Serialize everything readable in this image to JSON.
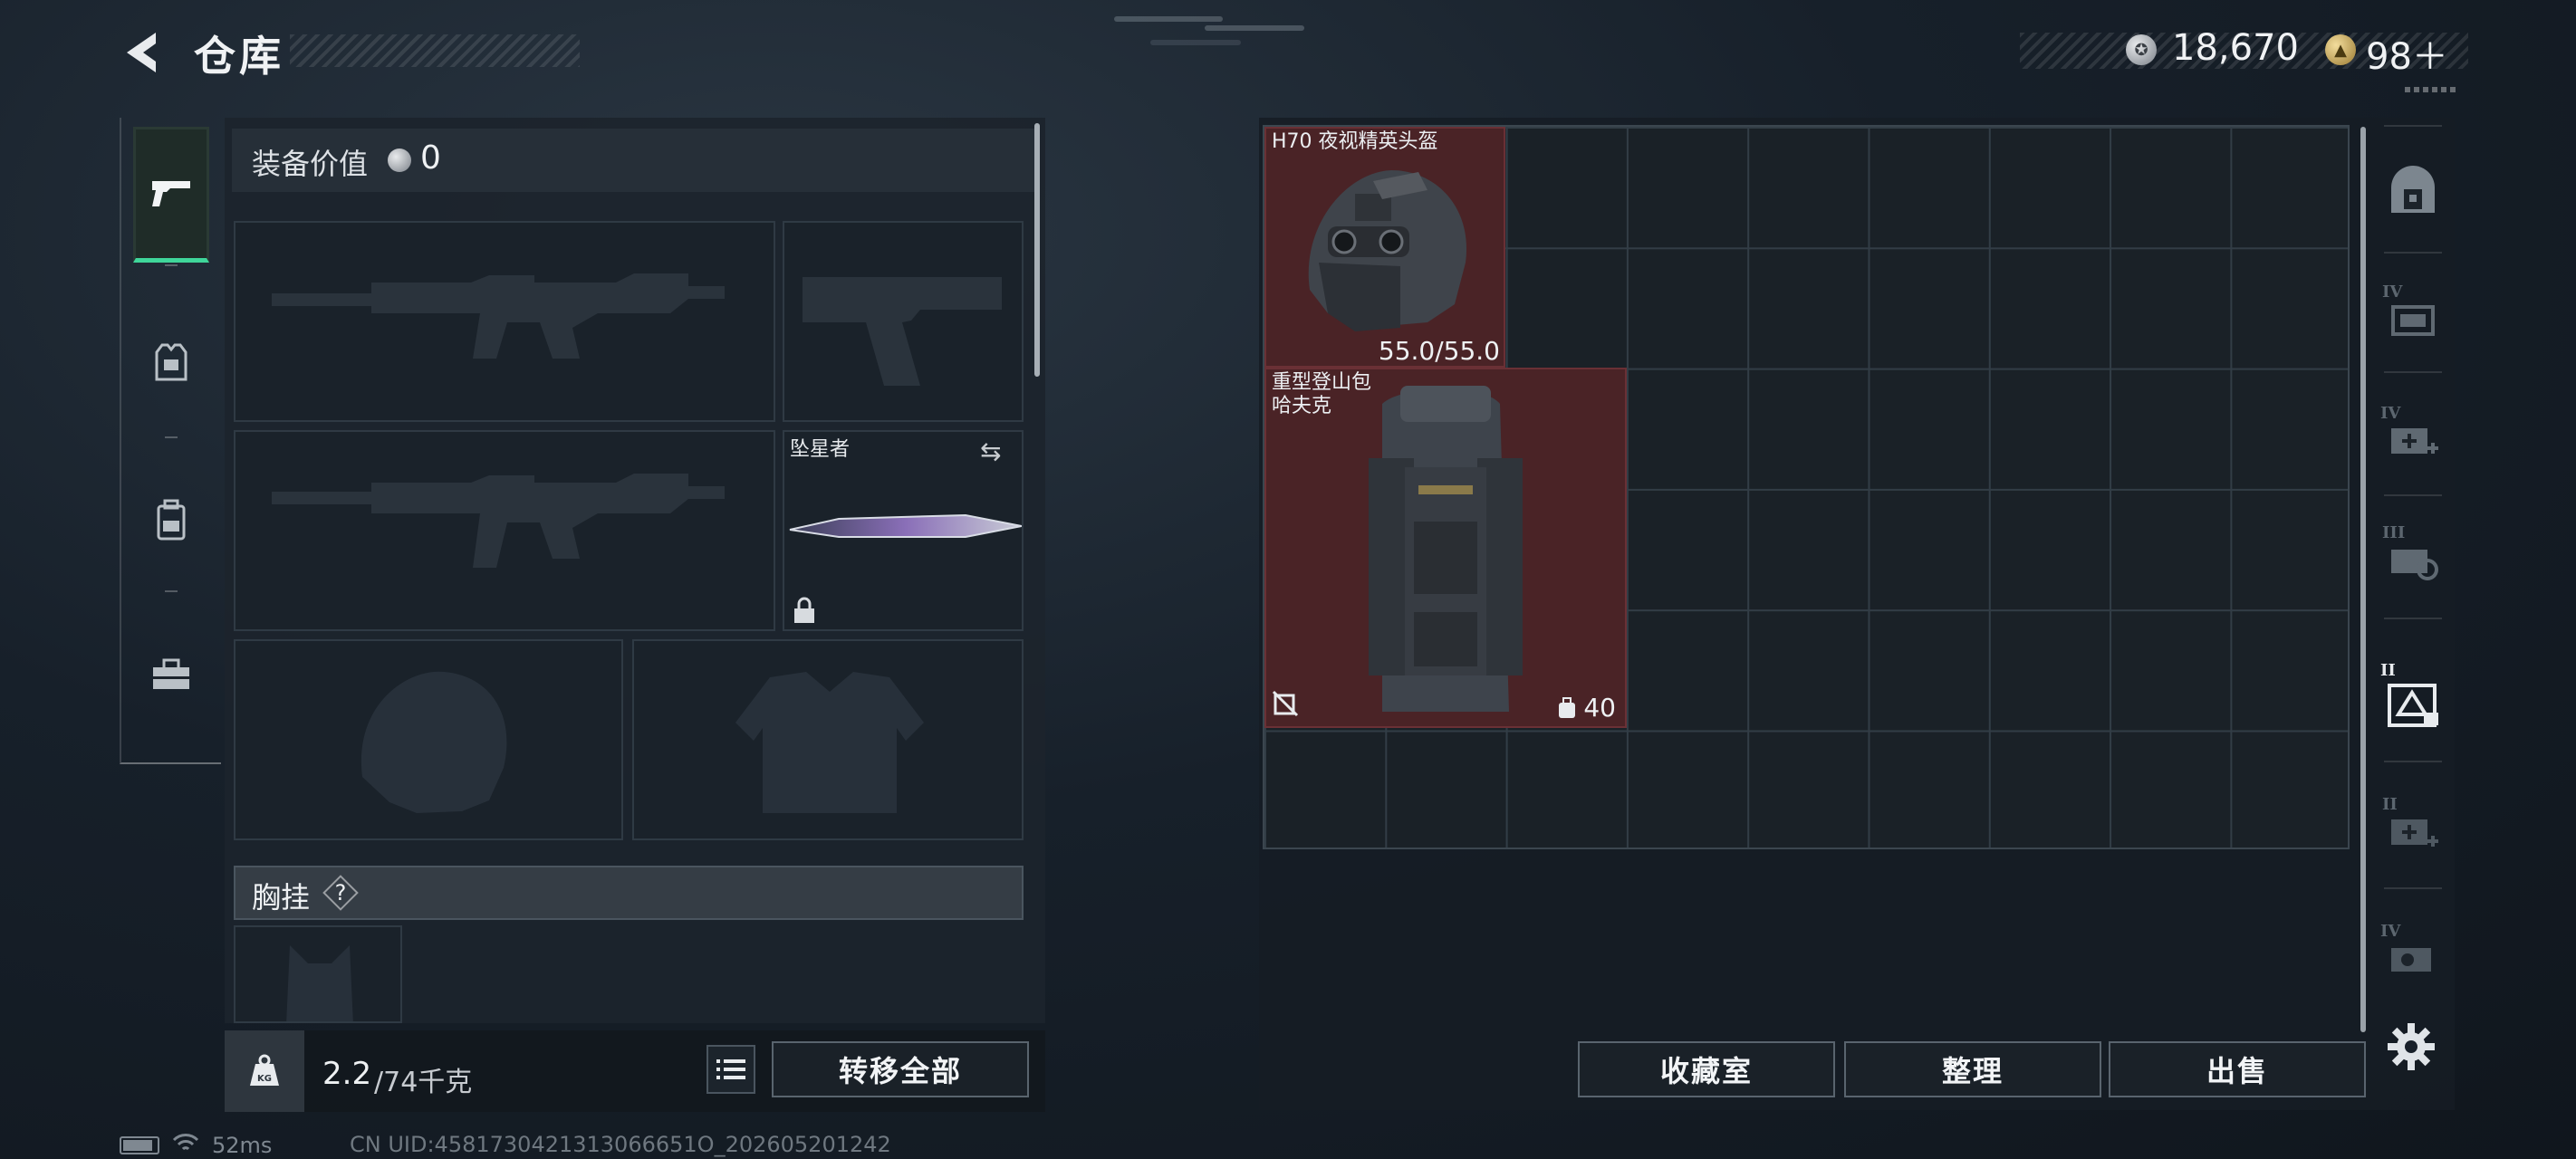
{
  "header": {
    "title": "仓库",
    "silver_amount": "18,670",
    "gold_amount": "98＋"
  },
  "left_tabs": [
    {
      "name": "weapons",
      "icon": "pistol-icon",
      "active": true
    },
    {
      "name": "armor",
      "icon": "armor-vest-icon",
      "active": false
    },
    {
      "name": "backpack",
      "icon": "backpack-icon",
      "active": false
    },
    {
      "name": "tools",
      "icon": "toolbox-icon",
      "active": false
    }
  ],
  "loadout": {
    "equip_value_label": "装备价值",
    "equip_value": "0",
    "melee_name": "坠星者",
    "chest_rig_label": "胸挂",
    "chest_rig_help": "?",
    "weight_current": "2.2",
    "weight_max": "/74千克",
    "transfer_all_label": "转移全部"
  },
  "storage": {
    "items": [
      {
        "name": "H70 夜视精英头盔",
        "durability": "55.0/55.0"
      },
      {
        "name_line1": "重型登山包",
        "name_line2": "哈夫克",
        "capacity": "40"
      }
    ],
    "buttons": {
      "collection": "收藏室",
      "sort": "整理",
      "sell": "出售"
    }
  },
  "right_tabs": [
    {
      "icon": "safe-box-icon",
      "label": ""
    },
    {
      "icon": "storage-iv-icon",
      "label": "IV"
    },
    {
      "icon": "storage-iv-plus-icon",
      "label": "IV"
    },
    {
      "icon": "storage-iii-icon",
      "label": "III"
    },
    {
      "icon": "storage-ii-locked-icon",
      "label": "II"
    },
    {
      "icon": "storage-ii-plus-icon",
      "label": "II"
    },
    {
      "icon": "storage-iv-extra-icon",
      "label": "IV"
    }
  ],
  "status": {
    "ping": "52ms",
    "uid": "CN UID:4581730421313066651O_202605201242"
  },
  "colors": {
    "accent_green": "#3fd69a",
    "item_bg_red": "#4a2326",
    "panel_bg": "#1c242c"
  }
}
